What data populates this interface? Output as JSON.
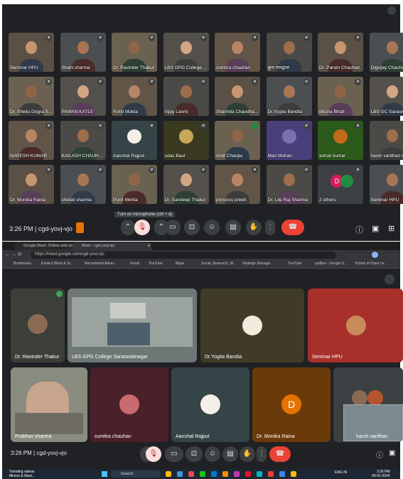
{
  "top_meeting": {
    "participants": [
      {
        "name": "Seminar HPU",
        "mic": "off"
      },
      {
        "name": "Shahi sharma",
        "mic": "off"
      },
      {
        "name": "Dr. Ravinder Thakur",
        "mic": "off"
      },
      {
        "name": "LBS GPG College ...",
        "mic": "off"
      },
      {
        "name": "sumitra chauhan",
        "mic": "off"
      },
      {
        "name": "कुल भारद्वाज",
        "mic": "off"
      },
      {
        "name": "Dr. Param Chauhan",
        "mic": "off"
      },
      {
        "name": "Digvijay Chauhan",
        "mic": "off"
      },
      {
        "name": "Dr. Shellu Dogra S...",
        "mic": "off"
      },
      {
        "name": "PAWAN KATLE",
        "mic": "off"
      },
      {
        "name": "Rohit Mukta",
        "mic": "off"
      },
      {
        "name": "Vijay Laxmi",
        "mic": "off"
      },
      {
        "name": "Sharmila Chaudha...",
        "mic": "off"
      },
      {
        "name": "Dr.Yogita Bandta",
        "mic": "off"
      },
      {
        "name": "diksha Bhatt",
        "mic": "off"
      },
      {
        "name": "LBS GC Saraswati...",
        "mic": "off"
      },
      {
        "name": "NARESH KUMAR",
        "mic": "off"
      },
      {
        "name": "KAILASH CHAUH...",
        "mic": "off"
      },
      {
        "name": "Aanchal Rajput",
        "mic": "off"
      },
      {
        "name": "udas Baul",
        "mic": "off"
      },
      {
        "name": "Amit Chanjla",
        "mic": "on"
      },
      {
        "name": "Man Mohan",
        "mic": "off"
      },
      {
        "name": "ashok kumar",
        "mic": "off"
      },
      {
        "name": "harsh vardhan sin...",
        "mic": "off"
      },
      {
        "name": "Dr. Monika Raina",
        "mic": "off"
      },
      {
        "name": "shefali sharma",
        "mic": "off"
      },
      {
        "name": "Punit Mehta",
        "mic": "off"
      },
      {
        "name": "Dr. Sandeep Thakur",
        "mic": "off"
      },
      {
        "name": "princess preeti",
        "mic": "off"
      },
      {
        "name": "Dr. Lile Raj Sharma",
        "mic": "off"
      },
      {
        "name": "2 others",
        "mic": "off"
      },
      {
        "name": "Seminar HPU",
        "mic": "off"
      }
    ],
    "others_avatar_letter": "D",
    "time_code": "3:26 PM  |  cgd-yovj-vjo",
    "tooltip": "Turn on microphone (ctrl + d)"
  },
  "browser": {
    "tabs": [
      "Google Meet: Online web and vi...",
      "Meet - cgd-yovj-vjo"
    ],
    "new_tab": "+",
    "url": "https://meet.google.com/cgd-yovj-vjo",
    "bookmarks": [
      "Bookmarks",
      "Exotica Black & Si...",
      "Recruitment Adver...",
      "Gmail",
      "YouTube",
      "Maps",
      "Social_Research_M...",
      "Strategic Manage...",
      "YouTube",
      "quillbot - Google S...",
      "School of Open Le..."
    ],
    "participants": [
      {
        "name": "Dr. Ravinder Thakur"
      },
      {
        "name": "LBS GPG College Saraswatinagar"
      },
      {
        "name": "Dr.Yogita Bandta"
      },
      {
        "name": "Seminar HPU"
      },
      {
        "name": "Prabhav sharma"
      },
      {
        "name": "sumitra chauhan"
      },
      {
        "name": "Aanchal Rajput"
      },
      {
        "name": "Dr. Monika Raina"
      },
      {
        "name": "harsh vardhan"
      }
    ],
    "monika_letter": "D",
    "time_code": "3:26 PM  |  cgd-yovj-vjo",
    "taskbar": {
      "news": "Trending videos",
      "news_sub": "Minors & Mast...",
      "search": "Search",
      "lang": "ENG IN",
      "clock": "3:26 PM",
      "date": "09-02-2024"
    }
  },
  "colors": {
    "meet_bg": "#202124",
    "tile": "#3c4043",
    "hangup": "#ea4335",
    "monika_avatar": "#e37400",
    "others_avatar": "#d81b60",
    "seminar_tile": "#a8302a",
    "yogita_tile": "#3f3b28"
  }
}
